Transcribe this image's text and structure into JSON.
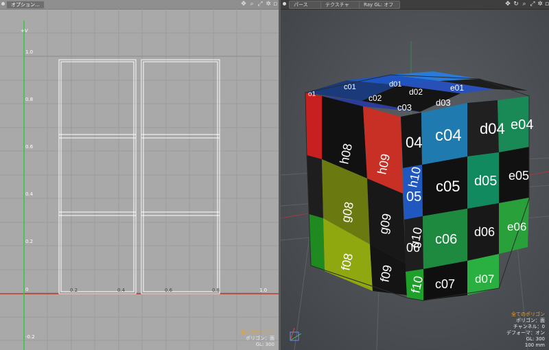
{
  "uv_view": {
    "option_label": "オプション...",
    "v_axis_label": "+V",
    "v_ticks": [
      "1.0",
      "0.8",
      "0.6",
      "0.4",
      "0.2",
      "0",
      "-0.2"
    ],
    "u_ticks": [
      "0.2",
      "0.4",
      "0.6",
      "0.8",
      "1.0"
    ],
    "info": [
      "全てのポリゴン",
      "ポリゴン：面",
      "GL: 300"
    ]
  },
  "viewport": {
    "buttons": [
      "パース",
      "テクスチャ",
      "Ray GL: オフ"
    ],
    "info": [
      "全てのポリゴン",
      "ポリゴン：面",
      "チャンネル：0",
      "デフォーマ：オン",
      "GL: 300",
      "100 mm"
    ],
    "cube_labels": {
      "top": [
        "o1",
        "c01",
        "d01",
        "c02",
        "d02",
        "e01",
        "c03",
        "d03"
      ],
      "right": [
        "04",
        "c04",
        "d04",
        "e04",
        "c05",
        "d05",
        "e05",
        "05",
        "c06",
        "d06",
        "e06",
        "06",
        "c07",
        "d07"
      ],
      "left": [
        "h08",
        "h09",
        "h10",
        "g08",
        "g09",
        "g10",
        "f08",
        "f09",
        "f10"
      ]
    }
  },
  "colors": {
    "uv_background": "#a9a9a9",
    "viewport_background": "#4f5257",
    "u_axis": "#c0392b",
    "v_axis": "#2ecc40",
    "info_highlight": "#f0a020"
  }
}
